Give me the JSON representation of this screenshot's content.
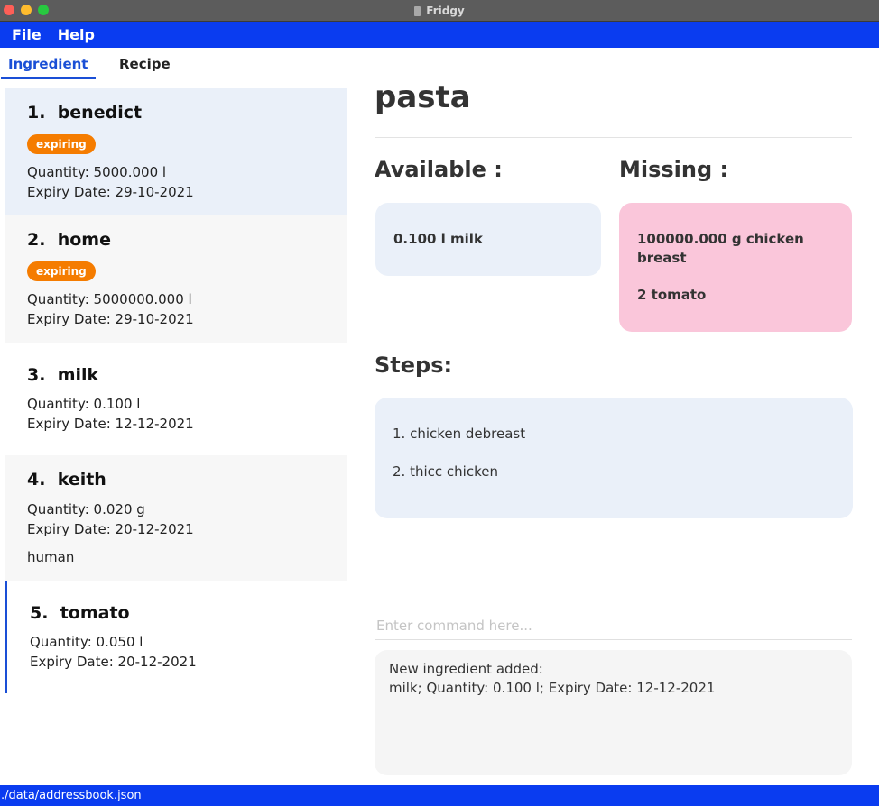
{
  "window": {
    "title": "Fridgy"
  },
  "menu": {
    "file": "File",
    "help": "Help"
  },
  "tabs": {
    "ingredient": "Ingredient",
    "recipe": "Recipe"
  },
  "ingredients": [
    {
      "index": "1.",
      "name": "benedict",
      "tag": "expiring",
      "quantity": "Quantity: 5000.000 l",
      "expiry": "Expiry Date: 29-10-2021"
    },
    {
      "index": "2.",
      "name": "home",
      "tag": "expiring",
      "quantity": "Quantity: 5000000.000 l",
      "expiry": "Expiry Date: 29-10-2021"
    },
    {
      "index": "3.",
      "name": "milk",
      "quantity": "Quantity: 0.100 l",
      "expiry": "Expiry Date: 12-12-2021"
    },
    {
      "index": "4.",
      "name": "keith",
      "quantity": "Quantity: 0.020 g",
      "expiry": "Expiry Date: 20-12-2021",
      "description": "human"
    },
    {
      "index": "5.",
      "name": "tomato",
      "quantity": "Quantity: 0.050 l",
      "expiry": "Expiry Date: 20-12-2021"
    }
  ],
  "recipe": {
    "title": "pasta",
    "available_label": "Available :",
    "missing_label": "Missing :",
    "steps_label": "Steps:",
    "available": [
      "0.100 l milk"
    ],
    "missing": [
      "100000.000 g chicken breast",
      "2 tomato"
    ],
    "steps": [
      "1. chicken debreast",
      "2. thicc chicken"
    ]
  },
  "command": {
    "placeholder": "Enter command here...",
    "value": ""
  },
  "result": {
    "line1": "New ingredient added:",
    "line2": "milk; Quantity: 0.100 l; Expiry Date: 12-12-2021"
  },
  "status": {
    "path": "./data/addressbook.json"
  },
  "colors": {
    "accent": "#0a3cf0",
    "expiring_badge": "#f57c00",
    "available_box": "#eaf0f9",
    "missing_box": "#fac6da",
    "selected_card": "#eaf0f9",
    "alt_card": "#f7f7f7"
  }
}
